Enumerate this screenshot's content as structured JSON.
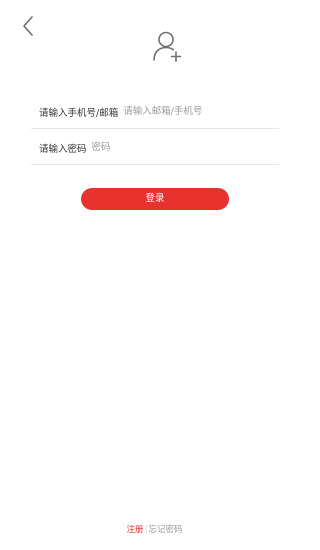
{
  "icons": {
    "back": "chevron-left-icon",
    "avatar": "add-user-icon"
  },
  "form": {
    "account": {
      "label": "请输入手机号/邮箱",
      "placeholder": "请输入邮箱/手机号",
      "value": ""
    },
    "password": {
      "label": "请输入密码",
      "placeholder": "密码",
      "value": ""
    }
  },
  "login_button": {
    "label": "登录"
  },
  "footer": {
    "register_label": "注册",
    "divider": "|",
    "forgot_label": "忘记密码"
  },
  "colors": {
    "accent": "#e8322e",
    "text": "#333333",
    "placeholder": "#9a9a9a",
    "divider": "#e6e6e6",
    "icon": "#6f6f6f"
  }
}
